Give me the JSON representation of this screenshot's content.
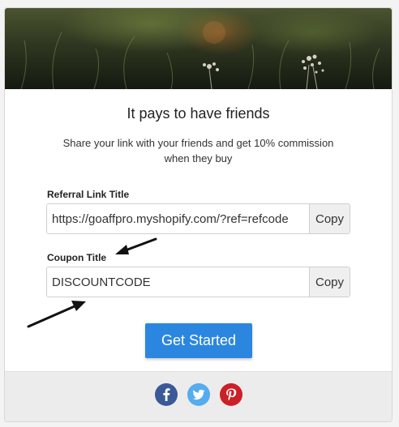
{
  "hero": {
    "image": "meadow-flowers-banner"
  },
  "title": "It pays to have friends",
  "subtitle": "Share your link with your friends and get 10% commission when they buy",
  "referral": {
    "label": "Referral Link Title",
    "value": "https://goaffpro.myshopify.com/?ref=refcode",
    "copy_label": "Copy"
  },
  "coupon": {
    "label": "Coupon Title",
    "value": "DISCOUNTCODE",
    "copy_label": "Copy"
  },
  "cta_label": "Get Started",
  "social": [
    {
      "name": "facebook",
      "icon": "facebook-icon",
      "color": "#3b5998"
    },
    {
      "name": "twitter",
      "icon": "twitter-icon",
      "color": "#55acee"
    },
    {
      "name": "pinterest",
      "icon": "pinterest-icon",
      "color": "#cb2027"
    }
  ],
  "colors": {
    "accent": "#2b86e0",
    "annotation_arrow": "#111111"
  }
}
